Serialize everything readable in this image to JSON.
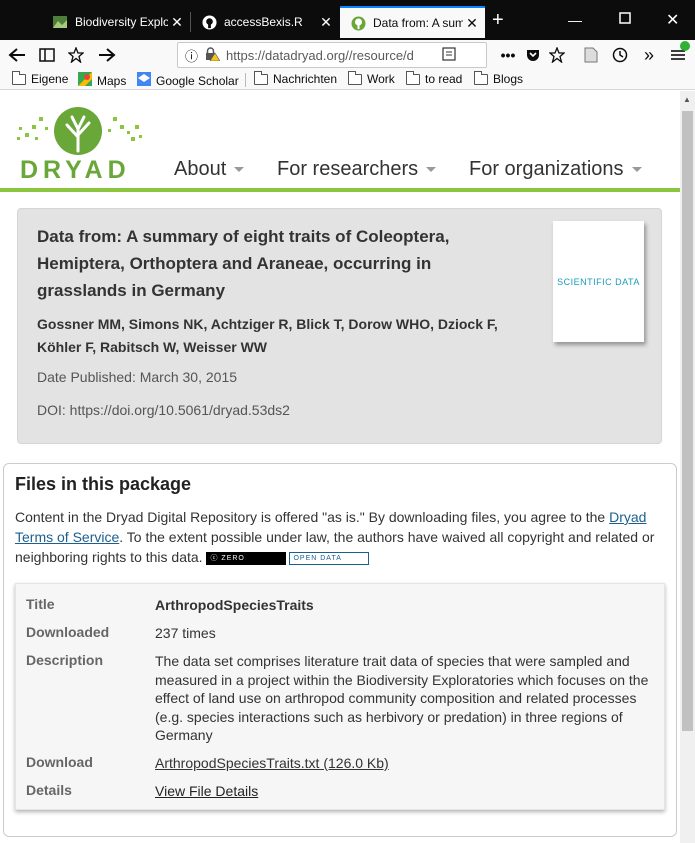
{
  "browser": {
    "tabs": [
      {
        "title": "Biodiversity Explo",
        "icon": "biodiversity-favicon"
      },
      {
        "title": "accessBexis.R",
        "icon": "github-icon"
      },
      {
        "title": "Data from: A sum",
        "icon": "dryad-favicon",
        "active": true
      }
    ],
    "url": "https://datadryad.org//resource/d",
    "bookmarks": [
      "Eigene",
      "Maps",
      "Google Scholar",
      "Nachrichten",
      "Work",
      "to read",
      "Blogs"
    ]
  },
  "site": {
    "logo_text": "DRYAD",
    "nav": [
      "About",
      "For researchers",
      "For organizations"
    ]
  },
  "citation": {
    "title": "Data from: A summary of eight traits of Coleoptera, Hemiptera, Orthoptera and Araneae, occurring in grasslands in Germany",
    "authors": "Gossner MM, Simons NK, Achtziger R, Blick T, Dorow WHO, Dziock F, Köhler F, Rabitsch W, Weisser WW",
    "date": "Date Published: March 30, 2015",
    "doi": "DOI: https://doi.org/10.5061/dryad.53ds2",
    "journal": "SCIENTIFIC DATA"
  },
  "files": {
    "heading": "Files in this package",
    "notice_pre": "Content in the Dryad Digital Repository is offered \"as is.\" By downloading files, you agree to the ",
    "notice_link": "Dryad Terms of Service",
    "notice_post": ". To the extent possible under law, the authors have waived all copyright and related or neighboring rights to this data.",
    "badge_cc": "ZERO",
    "badge_od": "OPEN DATA",
    "labels": {
      "title": "Title",
      "downloaded": "Downloaded",
      "description": "Description",
      "download": "Download",
      "details": "Details"
    },
    "values": {
      "title": "ArthropodSpeciesTraits",
      "downloaded": "237 times",
      "description": "The data set comprises literature trait data of species that were sampled and measured in a project within the Biodiversity Exploratories which focuses on the effect of land use on arthropod community composition and related processes (e.g. species interactions such as herbivory or predation) in three regions of Germany",
      "download": "ArthropodSpeciesTraits.txt (126.0 Kb)",
      "details": "View File Details"
    }
  }
}
